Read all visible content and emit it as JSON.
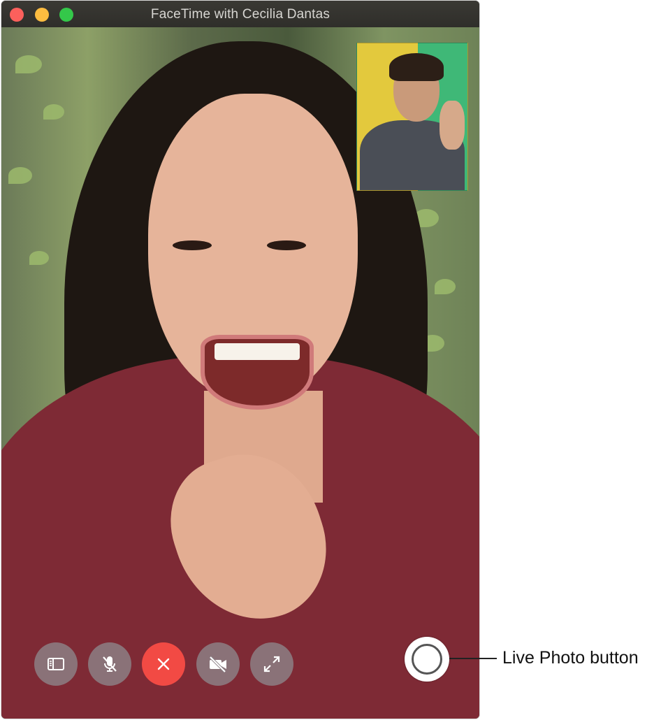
{
  "window": {
    "title": "FaceTime with Cecilia Dantas",
    "traffic_lights": {
      "close": "#fc605c",
      "minimize": "#fdbc40",
      "maximize": "#34c84a"
    }
  },
  "controls": [
    {
      "name": "sidebar-button",
      "icon": "sidebar-icon"
    },
    {
      "name": "mute-button",
      "icon": "microphone-slash-icon"
    },
    {
      "name": "end-call-button",
      "icon": "close-x-icon",
      "color": "#f24a44"
    },
    {
      "name": "video-off-button",
      "icon": "video-camera-slash-icon"
    },
    {
      "name": "fullscreen-button",
      "icon": "expand-arrows-icon"
    }
  ],
  "live_photo": {
    "callout_label": "Live Photo button"
  }
}
